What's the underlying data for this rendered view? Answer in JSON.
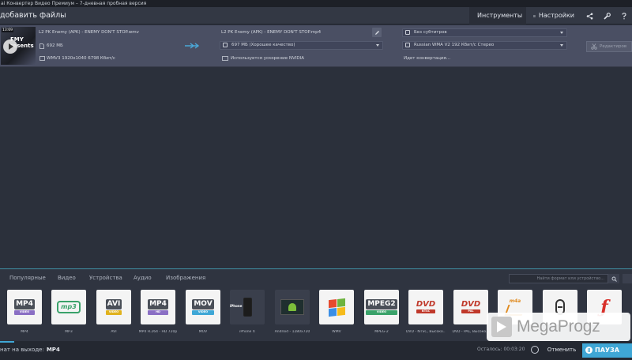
{
  "window": {
    "title": "ai Конвертер Видео Премиум – 7-дневная пробная версия"
  },
  "toolbar": {
    "add_files": "добавить файлы",
    "tools": "Инструменты",
    "settings": "Настройки",
    "share_icon": "share-icon",
    "wrench_icon": "wrench-icon"
  },
  "file": {
    "thumb_time": "13:69",
    "thumb_title": "EMY\nresents",
    "source_name": "L2 PK Enemy (APK) - ENEMY DON'T STOP.wmv",
    "source_size": "692 МБ",
    "source_info": "WMV3 1920x1040 6798 Кбит/с",
    "output_name": "L2 PK Enemy (APK) - ENEMY DON'T STOP.mp4",
    "output_size": "697 МБ (Хорошее качество)",
    "accel": "Используется ускорение NVIDIA",
    "subtitles": "Без субтитров",
    "audio": "Russian WMA V2 192 Кбит/с Стерео",
    "status": "Идет конвертация...",
    "edit_label": "Редактиров"
  },
  "formats": {
    "tabs": [
      "Популярные",
      "Видео",
      "Устройства",
      "Аудио",
      "Изображения"
    ],
    "search_placeholder": "Найти формат или устройство...",
    "tiles": [
      {
        "badge": "MP4",
        "sub": "VIDEO",
        "sub_color": "#8a6fc4",
        "label": "MP4"
      },
      {
        "badge": "mp3",
        "sub": "",
        "sub_color": "#3aa26a",
        "label": "MP3"
      },
      {
        "badge": "AVI",
        "sub": "VIDEO",
        "sub_color": "#e0b21e",
        "label": "AVI"
      },
      {
        "badge": "MP4",
        "sub": "HD",
        "sub_color": "#8a6fc4",
        "label": "MP4 H.264 - HD 720p"
      },
      {
        "badge": "MOV",
        "sub": "VIDEO",
        "sub_color": "#3fa7d6",
        "label": "MOV"
      },
      {
        "badge": "iPhone",
        "sub": "",
        "sub_color": "#e05a7a",
        "label": "iPhone X"
      },
      {
        "badge": "android",
        "sub": "",
        "sub_color": "#7cbf3a",
        "label": "Android - 1280x720"
      },
      {
        "badge": "win",
        "sub": "",
        "sub_color": "#3fa7d6",
        "label": "WMV"
      },
      {
        "badge": "MPEG2",
        "sub": "VIDEO",
        "sub_color": "#3aa26a",
        "label": "MPEG-2"
      },
      {
        "badge": "DVD",
        "sub": "NTSC",
        "sub_color": "#c0392b",
        "label": "DVD - NTSC, Высоко..."
      },
      {
        "badge": "DVD",
        "sub": "PAL",
        "sub_color": "#c0392b",
        "label": "DVD - PAL, Высоко..."
      },
      {
        "badge": "m4a",
        "sub": "",
        "sub_color": "#e08a1e",
        "label": ""
      },
      {
        "badge": "flac",
        "sub": "",
        "sub_color": "#333",
        "label": ""
      },
      {
        "badge": "flash",
        "sub": "",
        "sub_color": "#d8302a",
        "label": ""
      }
    ]
  },
  "bottom": {
    "output_label": "нат на выходе:",
    "output_value": "MP4",
    "remaining": "Осталось: 00:03:20",
    "cancel": "Отменить",
    "pause": "ПАУЗА"
  },
  "watermark": {
    "text": "MegaProgz"
  },
  "colors": {
    "accent": "#3fa7d6",
    "file_row": "#4a4f63",
    "background": "#2b303b"
  }
}
